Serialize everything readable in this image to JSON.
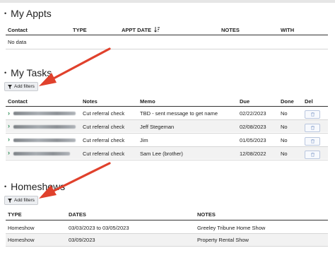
{
  "appts": {
    "title": "My Appts",
    "columns": [
      "Contact",
      "TYPE",
      "APPT DATE",
      "NOTES",
      "WITH"
    ],
    "empty_text": "No data"
  },
  "tasks": {
    "title": "My Tasks",
    "filter_label": "Add filters",
    "columns": [
      "Contact",
      "Notes",
      "Memo",
      "Due",
      "Done",
      "Del"
    ],
    "rows": [
      {
        "notes": "Cut referral check",
        "memo": "TBD - sent message to get name",
        "due": "02/22/2023",
        "done": "No"
      },
      {
        "notes": "Cut referral check",
        "memo": "Jeff Stegeman",
        "due": "02/08/2023",
        "done": "No"
      },
      {
        "notes": "Cut referral check",
        "memo": "Jim",
        "due": "01/05/2023",
        "done": "No"
      },
      {
        "notes": "Cut referral check",
        "memo": "Sam Lee (brother)",
        "due": "12/08/2022",
        "done": "No"
      }
    ]
  },
  "homeshows": {
    "title": "Homeshows",
    "filter_label": "Add filters",
    "columns": [
      "TYPE",
      "DATES",
      "NOTES"
    ],
    "rows": [
      {
        "type": "Homeshow",
        "dates": "03/03/2023 to 03/05/2023",
        "notes": "Greeley Tribune Home Show"
      },
      {
        "type": "Homeshow",
        "dates": "03/09/2023",
        "notes": "Property Rental Show"
      }
    ]
  },
  "colors": {
    "arrow": "#e0412c",
    "chevron": "#2e8b57",
    "row_alt": "#f2f2f2"
  }
}
